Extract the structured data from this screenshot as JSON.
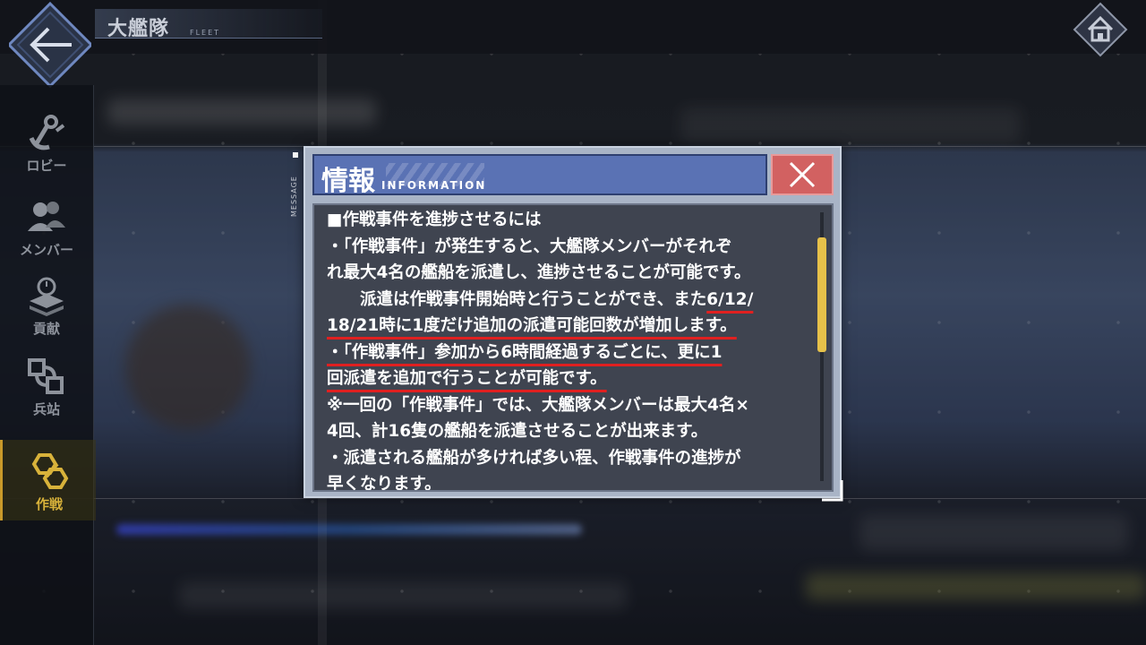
{
  "header": {
    "title": "大艦隊",
    "subtitle": "FLEET"
  },
  "sidebar": {
    "items": [
      {
        "label": "ロビー",
        "icon": "anchor-icon"
      },
      {
        "label": "メンバー",
        "icon": "members-icon"
      },
      {
        "label": "貢献",
        "icon": "contribution-icon"
      },
      {
        "label": "兵站",
        "icon": "logistics-icon"
      },
      {
        "label": "作戦",
        "icon": "operation-icon",
        "active": true
      }
    ]
  },
  "dialog": {
    "side_label": "MESSAGE",
    "title": "情報",
    "title_sub": "INFORMATION",
    "lines": {
      "l1": "■作戦事件を進捗させるには",
      "l2": "・「作戦事件」が発生すると、大艦隊メンバーがそれぞ",
      "l3": "れ最大4名の艦船を派遣し、進捗させることが可能です。",
      "l4a": "　　派遣は作戦事件開始時と行うことができ、また",
      "l4b": "6/12/",
      "l5": "18/21時に1度だけ追加の派遣可能回数が増加します。",
      "l6": "・「作戦事件」参加から6時間経過するごとに、更に1",
      "l7": "回派遣を追加で行うことが可能です。",
      "l8": "※一回の「作戦事件」では、大艦隊メンバーは最大4名×",
      "l9": "4回、計16隻の艦船を派遣させることが出来ます。",
      "l10": "・派遣される艦船が多ければ多い程、作戦事件の進捗が",
      "l11": "早くなります。"
    },
    "accent_color": "#5a72b4",
    "close_color": "#d26161",
    "underline_color": "#e02020",
    "scrollbar_color": "#e6c14a"
  }
}
